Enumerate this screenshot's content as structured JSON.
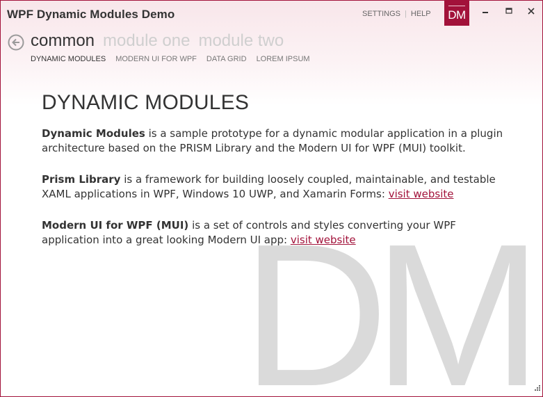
{
  "window": {
    "title": "WPF Dynamic Modules Demo",
    "logo_text": "DM",
    "links": [
      "SETTINGS",
      "HELP"
    ],
    "accent_color": "#a2123a"
  },
  "menu": {
    "groups": [
      {
        "label": "common",
        "selected": true
      },
      {
        "label": "module one",
        "selected": false
      },
      {
        "label": "module two",
        "selected": false
      }
    ],
    "sub_items": [
      {
        "label": "DYNAMIC MODULES",
        "selected": true
      },
      {
        "label": "MODERN UI FOR WPF",
        "selected": false
      },
      {
        "label": "DATA GRID",
        "selected": false
      },
      {
        "label": "LOREM IPSUM",
        "selected": false
      }
    ]
  },
  "content": {
    "heading": "DYNAMIC MODULES",
    "p1": {
      "bold": "Dynamic Modules",
      "text": " is a sample prototype for a dynamic modular application in a plugin architecture based on the PRISM Library and the Modern UI for WPF (MUI) toolkit."
    },
    "p2": {
      "bold": "Prism Library",
      "text": " is a framework for building loosely coupled, maintainable, and testable XAML applications in WPF, Windows 10 UWP, and Xamarin Forms: ",
      "link": "visit website"
    },
    "p3": {
      "bold": "Modern UI for WPF (MUI)",
      "text": " is a set of controls and styles converting your WPF application into a great looking Modern UI app: ",
      "link": "visit website"
    },
    "watermark": "DM"
  },
  "icons": {
    "back": "back-arrow-icon",
    "minimize": "minimize-icon",
    "maximize": "maximize-icon",
    "close": "close-icon",
    "resize": "resize-grip-icon"
  }
}
